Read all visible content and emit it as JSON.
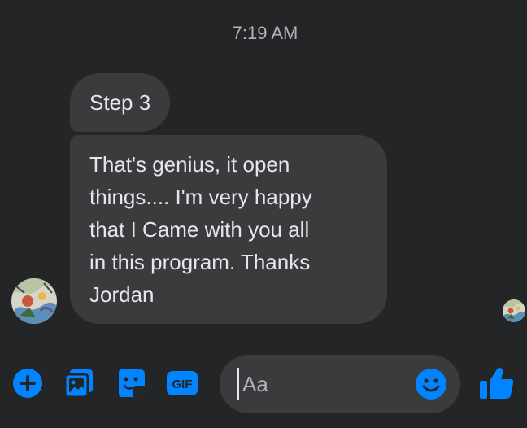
{
  "conversation": {
    "timestamp": "7:19 AM",
    "messages": [
      {
        "text": "Step 3"
      },
      {
        "text": "That's genius, it open\nthings.... I'm very happy\nthat I Came with you all\nin this program. Thanks\nJordan"
      }
    ]
  },
  "composer": {
    "placeholder": "Aa",
    "gif_label": "GIF",
    "icons": [
      "plus-icon",
      "photo-icon",
      "sticker-icon",
      "gif-icon",
      "emoji-icon",
      "thumbs-up-icon"
    ]
  },
  "colors": {
    "background": "#242526",
    "bubble": "#3a3b3c",
    "accent": "#0084ff",
    "text": "#e4e6eb",
    "muted": "#b0b3b8"
  }
}
